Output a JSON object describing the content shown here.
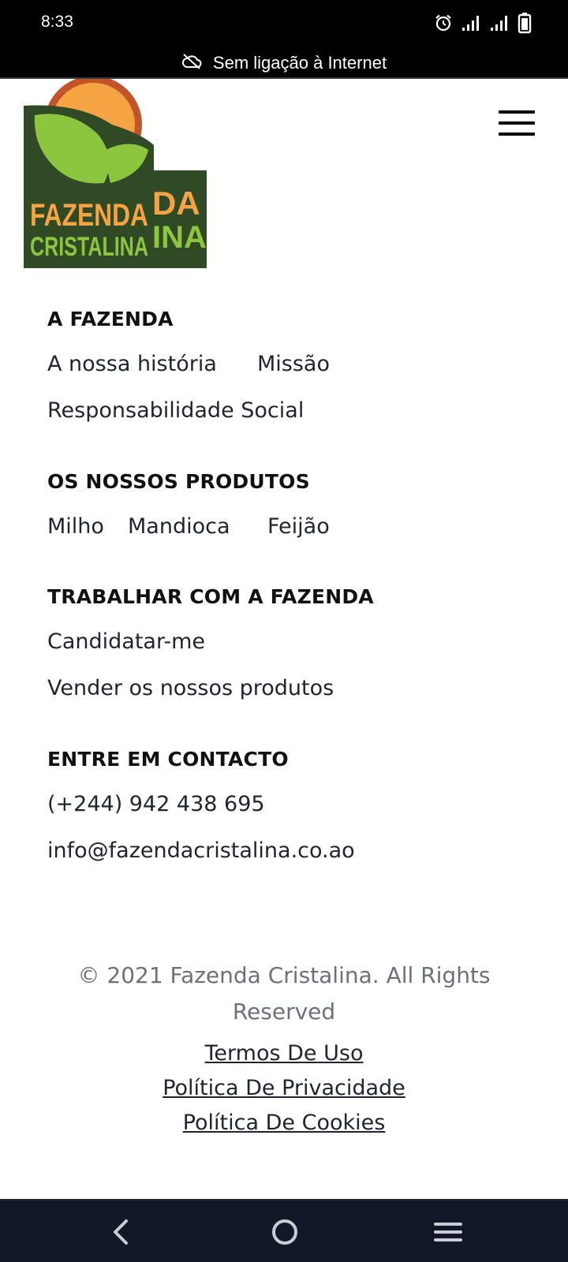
{
  "status_bar": {
    "time": "8:33",
    "icons": [
      "alarm-icon",
      "signal-icon",
      "signal-icon",
      "battery-icon"
    ]
  },
  "connectivity": {
    "icon": "cloud-off-icon",
    "message": "Sem ligação à Internet"
  },
  "header": {
    "logo": {
      "line1": "FAZENDA",
      "line2": "CRISTALINA",
      "partial1": "DA",
      "partial2": "INA"
    },
    "menu_icon": "hamburger-icon"
  },
  "footer": {
    "sections": [
      {
        "title": "A FAZENDA",
        "links": [
          "A nossa história",
          "Missão",
          "Responsabilidade Social"
        ]
      },
      {
        "title": "OS NOSSOS PRODUTOS",
        "links": [
          "Milho",
          "Mandioca",
          "Feijão"
        ]
      },
      {
        "title": "TRABALHAR COM A FAZENDA",
        "links": [
          "Candidatar-me",
          "Vender os nossos produtos"
        ]
      },
      {
        "title": "ENTRE EM CONTACTO",
        "links": [
          "(+244) 942 438 695",
          "info@fazendacristalina.co.ao"
        ]
      }
    ],
    "copyright": "© 2021 Fazenda Cristalina. All Rights Reserved",
    "legal_links": [
      "Termos De Uso",
      "Política De Privacidade",
      "Política De Cookies"
    ]
  },
  "nav_bar": {
    "buttons": [
      "back-icon",
      "home-icon",
      "recents-icon"
    ]
  },
  "colors": {
    "logo_dark_green": "#2f4a25",
    "logo_light_green": "#8cc63f",
    "logo_orange": "#f6a343",
    "logo_sun_rim": "#c2542a",
    "text": "#1f2430",
    "muted": "#6c7079"
  }
}
